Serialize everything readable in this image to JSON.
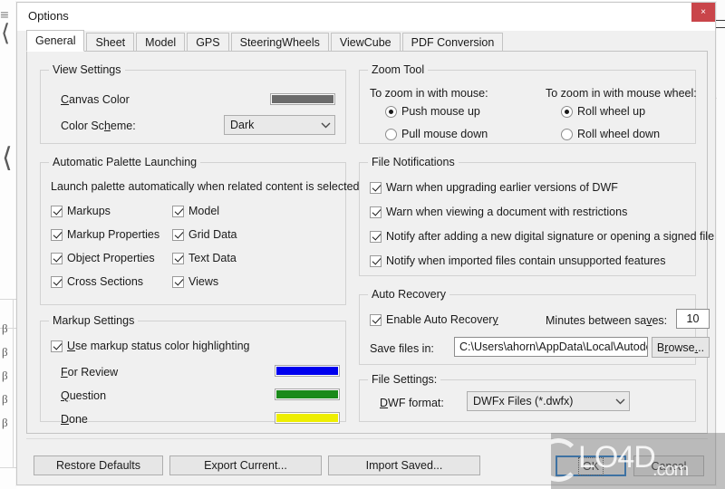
{
  "window": {
    "title": "Options",
    "close_label": "×"
  },
  "tabs": [
    {
      "label": "General",
      "active": true
    },
    {
      "label": "Sheet",
      "active": false
    },
    {
      "label": "Model",
      "active": false
    },
    {
      "label": "GPS",
      "active": false
    },
    {
      "label": "SteeringWheels",
      "active": false
    },
    {
      "label": "ViewCube",
      "active": false
    },
    {
      "label": "PDF Conversion",
      "active": false
    }
  ],
  "view_settings": {
    "legend": "View Settings",
    "canvas_color_label": "Canvas Color",
    "canvas_color_value": "#6b6b6b",
    "color_scheme_label": "Color Scheme:",
    "color_scheme_value": "Dark"
  },
  "automatic_palette_launching": {
    "legend": "Automatic Palette Launching",
    "description": "Launch palette automatically when related content is selected",
    "items_left": [
      {
        "label": "Markups",
        "checked": true
      },
      {
        "label": "Markup Properties",
        "checked": true
      },
      {
        "label": "Object Properties",
        "checked": true
      },
      {
        "label": "Cross Sections",
        "checked": true
      }
    ],
    "items_right": [
      {
        "label": "Model",
        "checked": true
      },
      {
        "label": "Grid Data",
        "checked": true
      },
      {
        "label": "Text Data",
        "checked": true
      },
      {
        "label": "Views",
        "checked": true
      }
    ]
  },
  "markup_settings": {
    "legend": "Markup Settings",
    "use_highlighting_label": "Use markup status color highlighting",
    "use_highlighting_checked": true,
    "statuses": [
      {
        "label": "For Review",
        "color": "#0000ee"
      },
      {
        "label": "Question",
        "color": "#1a8a1a"
      },
      {
        "label": "Done",
        "color": "#eeee00"
      }
    ]
  },
  "zoom_tool": {
    "legend": "Zoom Tool",
    "mouse_heading": "To zoom in with mouse:",
    "wheel_heading": "To zoom in with mouse wheel:",
    "mouse_options": [
      {
        "label": "Push mouse up",
        "selected": true
      },
      {
        "label": "Pull mouse down",
        "selected": false
      }
    ],
    "wheel_options": [
      {
        "label": "Roll wheel up",
        "selected": true
      },
      {
        "label": "Roll wheel down",
        "selected": false
      }
    ]
  },
  "file_notifications": {
    "legend": "File Notifications",
    "items": [
      {
        "label": "Warn when upgrading earlier versions of DWF",
        "checked": true
      },
      {
        "label": "Warn when viewing a document with restrictions",
        "checked": true
      },
      {
        "label": "Notify after adding a new digital signature or opening a signed file",
        "checked": true
      },
      {
        "label": "Notify when imported files contain unsupported features",
        "checked": true
      }
    ]
  },
  "auto_recovery": {
    "legend": "Auto Recovery",
    "enable_label": "Enable Auto Recovery",
    "enable_checked": true,
    "minutes_label": "Minutes between saves:",
    "minutes_value": "10",
    "save_files_label": "Save files in:",
    "save_files_value": "C:\\Users\\ahorn\\AppData\\Local\\Autode:",
    "browse_label": "Browse..."
  },
  "file_settings": {
    "legend": "File Settings:",
    "dwf_format_label": "DWF format:",
    "dwf_format_value": "DWFx Files (*.dwfx)"
  },
  "footer": {
    "restore_defaults": "Restore Defaults",
    "export_current": "Export Current...",
    "import_saved": "Import Saved...",
    "ok": "OK",
    "cancel": "Cancel"
  },
  "watermark": {
    "text": "LO4D",
    "suffix": ".com"
  }
}
